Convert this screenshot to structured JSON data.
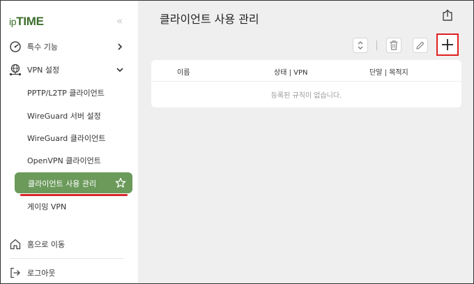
{
  "sidebar": {
    "logo_prefix": "ip",
    "logo_main": "TIME",
    "collapse_glyph": "«",
    "menu": [
      {
        "label": "특수 기능",
        "icon": "gauge-icon"
      },
      {
        "label": "VPN 설정",
        "icon": "vpn-network-icon"
      }
    ],
    "vpn_items": [
      "PPTP/L2TP 클라이언트",
      "WireGuard 서버 설정",
      "WireGuard 클라이언트",
      "OpenVPN 클라이언트"
    ],
    "active_item": "클라이언트 사용 관리",
    "after_active": "게이밍 VPN",
    "home_label": "홈으로 이동",
    "logout_label": "로그아웃"
  },
  "main": {
    "title": "클라이언트 사용 관리",
    "table": {
      "headers": [
        "이름",
        "상태 | VPN",
        "단말 | 목적지"
      ],
      "empty_message": "등록된 규칙이 없습니다."
    }
  },
  "colors": {
    "brand": "#3d6e2e",
    "active_bg": "#6b9a5b",
    "highlight": "#e02020"
  }
}
